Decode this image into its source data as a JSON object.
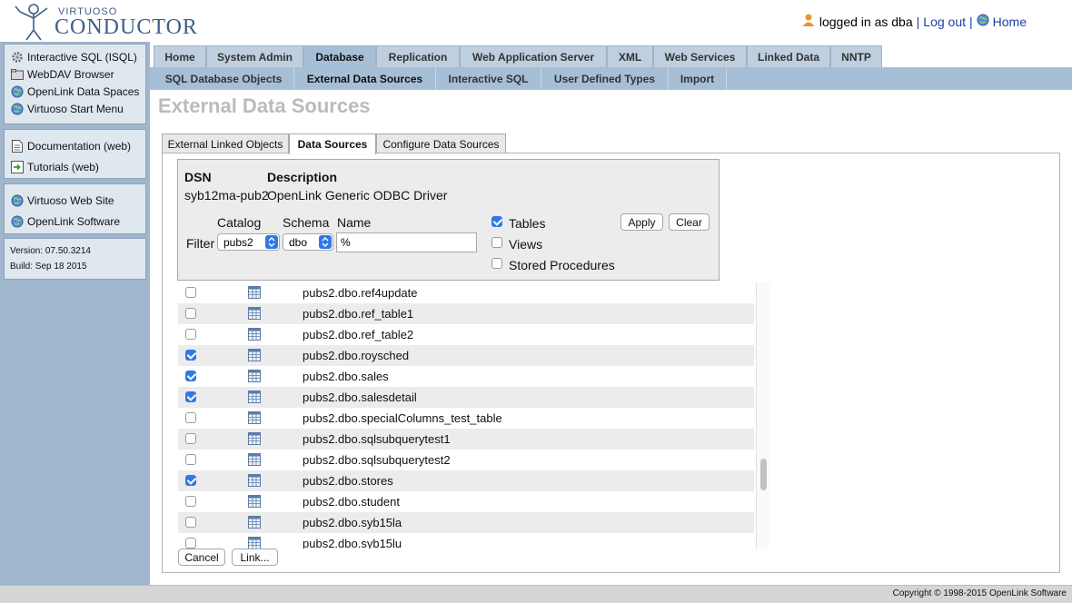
{
  "header": {
    "logo_small": "VIRTUOSO",
    "logo_big": "CONDUCTOR",
    "user_text": "logged in as dba",
    "sep1": "|",
    "logout_label": "Log out",
    "sep2": "|",
    "home_label": "Home"
  },
  "sidebar": {
    "group1": [
      {
        "label": "Interactive SQL (ISQL)",
        "icon": "gear-icon"
      },
      {
        "label": "WebDAV Browser",
        "icon": "folder-icon"
      },
      {
        "label": "OpenLink Data Spaces",
        "icon": "globe-icon"
      },
      {
        "label": "Virtuoso Start Menu",
        "icon": "globe-icon"
      }
    ],
    "group2": [
      {
        "label": "Documentation (web)",
        "icon": "document-icon"
      },
      {
        "label": "Tutorials (web)",
        "icon": "tutorial-icon"
      }
    ],
    "group3": [
      {
        "label": "Virtuoso Web Site",
        "icon": "globe-icon"
      },
      {
        "label": "OpenLink Software",
        "icon": "globe-icon"
      }
    ],
    "version": "Version: 07.50.3214",
    "build": "Build: Sep 18 2015"
  },
  "main_tabs": [
    "Home",
    "System Admin",
    "Database",
    "Replication",
    "Web Application Server",
    "XML",
    "Web Services",
    "Linked Data",
    "NNTP"
  ],
  "main_tab_active": "Database",
  "sub_tabs": [
    "SQL Database Objects",
    "External Data Sources",
    "Interactive SQL",
    "User Defined Types",
    "Import"
  ],
  "sub_tab_active": "External Data Sources",
  "page_title": "External Data Sources",
  "inner_tabs": [
    "External Linked Objects",
    "Data Sources",
    "Configure Data Sources"
  ],
  "inner_tab_active": "Data Sources",
  "dsn": {
    "dsn_header": "DSN",
    "desc_header": "Description",
    "dsn_value": "syb12ma-pub2",
    "desc_value": "OpenLink Generic ODBC Driver"
  },
  "filter": {
    "label": "Filter",
    "catalog_label": "Catalog",
    "schema_label": "Schema",
    "name_label": "Name",
    "catalog_value": "pubs2",
    "schema_value": "dbo",
    "name_value": "%",
    "tables_label": "Tables",
    "tables_checked": true,
    "views_label": "Views",
    "views_checked": false,
    "procs_label": "Stored Procedures",
    "procs_checked": false,
    "apply_label": "Apply",
    "clear_label": "Clear"
  },
  "tables": [
    {
      "name": "pubs2.dbo.ref4update",
      "checked": false
    },
    {
      "name": "pubs2.dbo.ref_table1",
      "checked": false
    },
    {
      "name": "pubs2.dbo.ref_table2",
      "checked": false
    },
    {
      "name": "pubs2.dbo.roysched",
      "checked": true
    },
    {
      "name": "pubs2.dbo.sales",
      "checked": true
    },
    {
      "name": "pubs2.dbo.salesdetail",
      "checked": true
    },
    {
      "name": "pubs2.dbo.specialColumns_test_table",
      "checked": false
    },
    {
      "name": "pubs2.dbo.sqlsubquerytest1",
      "checked": false
    },
    {
      "name": "pubs2.dbo.sqlsubquerytest2",
      "checked": false
    },
    {
      "name": "pubs2.dbo.stores",
      "checked": true
    },
    {
      "name": "pubs2.dbo.student",
      "checked": false
    },
    {
      "name": "pubs2.dbo.syb15la",
      "checked": false
    },
    {
      "name": "pubs2.dbo.syb15lu",
      "checked": false
    }
  ],
  "buttons": {
    "cancel_label": "Cancel",
    "link_label": "Link..."
  },
  "footer": {
    "copyright": "Copyright © 1998-2015 OpenLink Software"
  }
}
